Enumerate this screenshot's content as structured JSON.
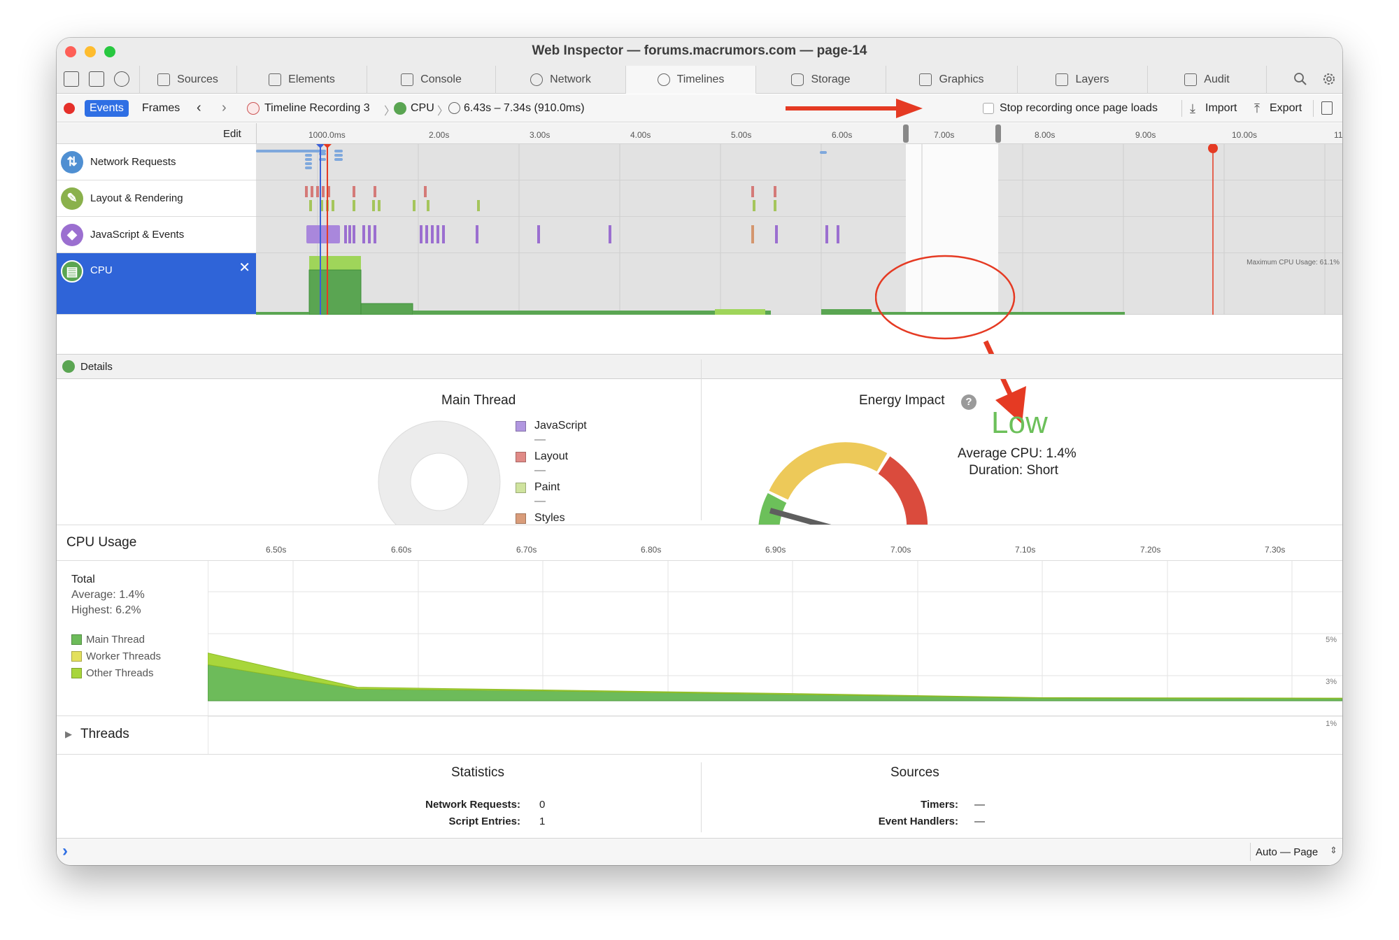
{
  "window": {
    "title": "Web Inspector — forums.macrumors.com — page-14"
  },
  "tabs": [
    {
      "label": "Sources",
      "icon": "doc-icon"
    },
    {
      "label": "Elements",
      "icon": "elements-icon"
    },
    {
      "label": "Console",
      "icon": "console-icon"
    },
    {
      "label": "Network",
      "icon": "network-icon"
    },
    {
      "label": "Timelines",
      "icon": "clock-icon",
      "active": true
    },
    {
      "label": "Storage",
      "icon": "database-icon"
    },
    {
      "label": "Graphics",
      "icon": "image-icon"
    },
    {
      "label": "Layers",
      "icon": "layers-icon"
    },
    {
      "label": "Audit",
      "icon": "audit-icon"
    }
  ],
  "toolbar": {
    "events_label": "Events",
    "frames_label": "Frames",
    "breadcrumb_recording": "Timeline Recording 3",
    "breadcrumb_cpu": "CPU",
    "breadcrumb_range": "6.43s – 7.34s (910.0ms)",
    "stop_label": "Stop recording once page loads",
    "import_label": "Import",
    "export_label": "Export"
  },
  "ruler": {
    "edit_label": "Edit",
    "ticks": [
      "1000.0ms",
      "2.00s",
      "3.00s",
      "4.00s",
      "5.00s",
      "6.00s",
      "7.00s",
      "8.00s",
      "9.00s",
      "10.00s",
      "11"
    ]
  },
  "timeline_rows": [
    {
      "label": "Network Requests",
      "color": "#4f8fd2"
    },
    {
      "label": "Layout & Rendering",
      "color": "#8ab14c"
    },
    {
      "label": "JavaScript & Events",
      "color": "#9b6fd0"
    },
    {
      "label": "CPU",
      "color": "#5aa552",
      "selected": true
    }
  ],
  "cpu_track": {
    "max_label": "Maximum CPU Usage: 61.1%"
  },
  "details": {
    "label": "Details"
  },
  "main_thread": {
    "title": "Main Thread",
    "legend": [
      {
        "label": "JavaScript",
        "value": "—",
        "color": "#b197e0"
      },
      {
        "label": "Layout",
        "value": "—",
        "color": "#e08a86"
      },
      {
        "label": "Paint",
        "value": "—",
        "color": "#cfe39e"
      },
      {
        "label": "Styles",
        "value": "—",
        "color": "#d99c7a"
      }
    ]
  },
  "energy": {
    "title": "Energy Impact",
    "help": "?",
    "rating": "Low",
    "average": "Average CPU: 1.4%",
    "duration": "Duration: Short",
    "gauge_level": 0.03
  },
  "cpu_usage": {
    "title": "CPU Usage",
    "ticks": [
      "6.50s",
      "6.60s",
      "6.70s",
      "6.80s",
      "6.90s",
      "7.00s",
      "7.10s",
      "7.20s",
      "7.30s"
    ],
    "total_label": "Total",
    "average": "Average: 1.4%",
    "highest": "Highest: 6.2%",
    "legend": [
      {
        "label": "Main Thread",
        "color": "#6dbb5a"
      },
      {
        "label": "Worker Threads",
        "color": "#e3e05e"
      },
      {
        "label": "Other Threads",
        "color": "#a8d63b"
      }
    ],
    "gridlines": [
      "5%",
      "3%",
      "1%"
    ]
  },
  "chart_data": {
    "type": "area",
    "x": [
      6.43,
      6.55,
      6.7,
      6.9,
      7.1,
      7.34
    ],
    "xlim": [
      6.43,
      7.34
    ],
    "ylim": [
      0,
      6.2
    ],
    "series": [
      {
        "name": "Main Thread",
        "values": [
          4.0,
          1.3,
          1.1,
          0.7,
          0.3,
          0.25
        ]
      },
      {
        "name": "Other Threads",
        "values": [
          1.3,
          0.2,
          0.1,
          0.1,
          0.05,
          0.05
        ]
      }
    ]
  },
  "threads": {
    "label": "Threads"
  },
  "statistics": {
    "title": "Statistics",
    "rows": [
      {
        "label": "Network Requests:",
        "value": "0"
      },
      {
        "label": "Script Entries:",
        "value": "1"
      }
    ]
  },
  "sources": {
    "title": "Sources",
    "rows": [
      {
        "label": "Timers:",
        "value": "—"
      },
      {
        "label": "Event Handlers:",
        "value": "—"
      }
    ]
  },
  "footer": {
    "prompt": "›",
    "context": "Auto — Page"
  }
}
